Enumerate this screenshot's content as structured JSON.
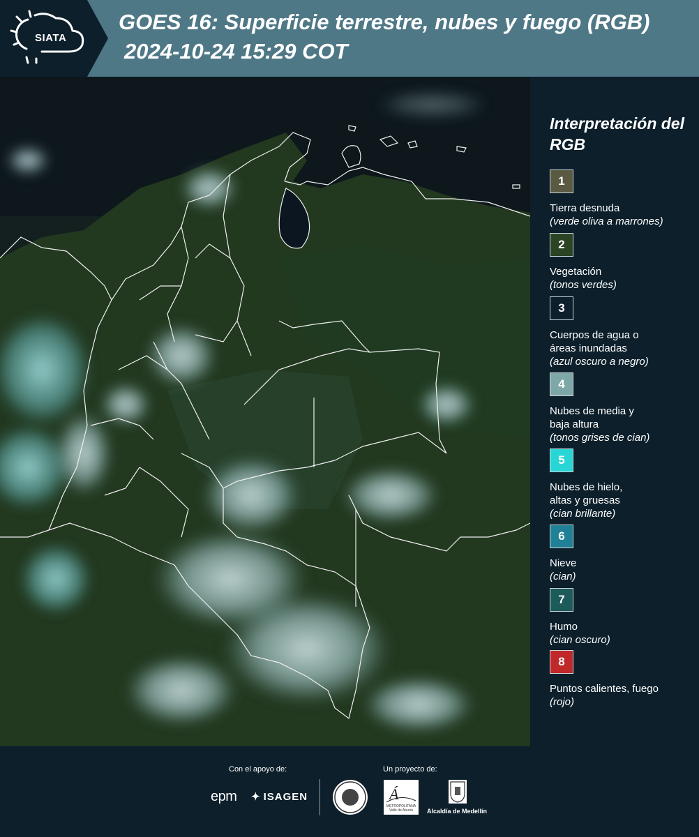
{
  "header": {
    "logo_text": "SIATA",
    "title_line1": "GOES 16: Superficie terrestre, nubes y fuego (RGB)",
    "title_line2": "2024-10-24 15:29 COT"
  },
  "map": {
    "description_icon": "satellite-rgb-image"
  },
  "legend": {
    "title": "Interpretación del RGB",
    "items": [
      {
        "number": "1",
        "label": "Tierra desnuda",
        "desc": "(verde oliva a marrones)",
        "color": "#5a5a42"
      },
      {
        "number": "2",
        "label": "Vegetación",
        "desc": "(tonos verdes)",
        "color": "#2b4423"
      },
      {
        "number": "3",
        "label": "Cuerpos de agua o áreas inundadas",
        "desc": "(azul oscuro a negro)",
        "color": "#0c1f2b"
      },
      {
        "number": "4",
        "label": "Nubes de media y baja altura",
        "desc": "(tonos grises de cian)",
        "color": "#7ea8a8"
      },
      {
        "number": "5",
        "label": "Nubes de hielo, altas y gruesas",
        "desc": "(cian brillante)",
        "color": "#29d6d6"
      },
      {
        "number": "6",
        "label": "Nieve",
        "desc": "(cian)",
        "color": "#1f8096"
      },
      {
        "number": "7",
        "label": "Humo",
        "desc": "(cian oscuro)",
        "color": "#1d5a5a"
      },
      {
        "number": "8",
        "label": "Puntos calientes, fuego",
        "desc": "(rojo)",
        "color": "#c0282a"
      }
    ]
  },
  "footer": {
    "support_label": "Con el apoyo de:",
    "project_label": "Un proyecto de:",
    "epm": "epm",
    "isagen": "ISAGEN",
    "amva_text": "METROPOLITANA Valle de Aburrá",
    "alcaldia": "Alcaldía de Medellín"
  }
}
